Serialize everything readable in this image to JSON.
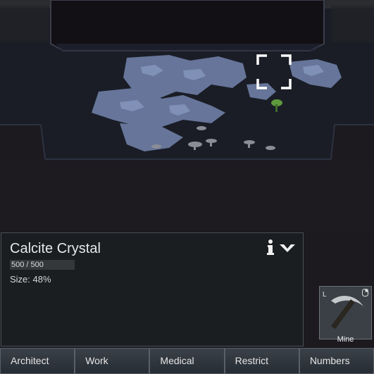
{
  "inspect": {
    "title": "Calcite Crystal",
    "hp_text": "500 / 500",
    "hp_fraction": 1.0,
    "size_text": "Size: 48%",
    "info_icon": "info-icon",
    "select_icon": "select-next-arrow-icon"
  },
  "gizmo": {
    "label": "Mine",
    "hotkey": "L",
    "icon": "pickaxe-icon"
  },
  "tabs": [
    {
      "label": "Architect"
    },
    {
      "label": "Work"
    },
    {
      "label": "Medical"
    },
    {
      "label": "Restrict"
    },
    {
      "label": "Numbers"
    }
  ],
  "colors": {
    "rock_dark": "#121014",
    "cave_floor": "#1a1d26",
    "crystal": "#6f7fa6",
    "panel_bg": "#1b1e21",
    "tab_bg": "#2f353c"
  }
}
